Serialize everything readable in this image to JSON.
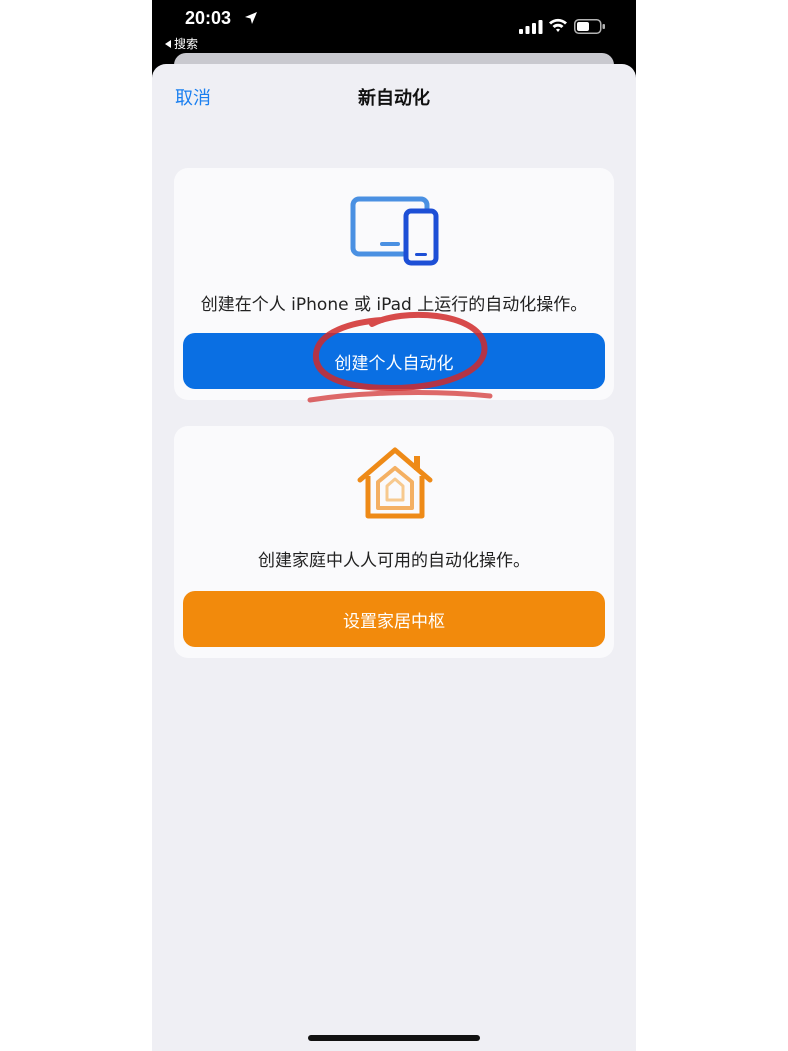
{
  "status_bar": {
    "time": "20:03",
    "back_app_label": "搜索"
  },
  "nav": {
    "cancel_label": "取消",
    "title": "新自动化"
  },
  "personal_card": {
    "icon": "devices-icon",
    "description": "创建在个人 iPhone 或 iPad 上运行的自动化操作。",
    "button_label": "创建个人自动化",
    "button_color": "#0a6fe3"
  },
  "home_card": {
    "icon": "home-icon",
    "description": "创建家庭中人人可用的自动化操作。",
    "button_label": "设置家居中枢",
    "button_color": "#f28a0c"
  },
  "colors": {
    "accent": "#1a7ff0",
    "annotation": "#d02a2a",
    "sheet_background": "#efeff4"
  }
}
